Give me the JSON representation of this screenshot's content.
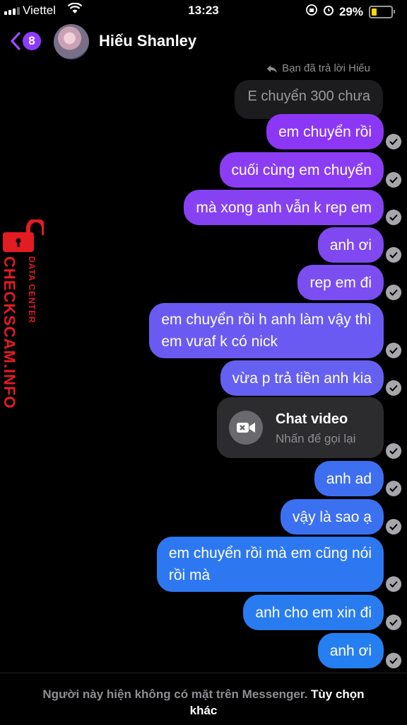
{
  "status": {
    "carrier": "Viettel",
    "time": "13:23",
    "battery": "29%",
    "accent": "#ffd60a"
  },
  "header": {
    "back_count": "8",
    "name": "Hiếu Shanley"
  },
  "reply_note": "Bạn đã trả lời Hiếu",
  "quoted": "E chuyển 300 chưa",
  "messages": [
    {
      "text": "em chuyển rồi",
      "color": "#8c37f5"
    },
    {
      "text": "cuối cùng em chuyển",
      "color": "#8a3df4"
    },
    {
      "text": "mà xong anh vẫn k rep em",
      "color": "#8642f2"
    },
    {
      "text": "anh ơi",
      "color": "#7f48f0"
    },
    {
      "text": "rep em đi",
      "color": "#7a4ef1"
    },
    {
      "text": "em chuyển rồi h anh làm vậy thì\nem vưaf k có nick",
      "color": "#6b5af1"
    },
    {
      "text": "vừa p trả tiền anh kia",
      "color": "#6560f2"
    },
    {
      "text": "anh ad",
      "color": "#3e6ff0"
    },
    {
      "text": "vậy là sao ạ",
      "color": "#3b70f0"
    },
    {
      "text": "em chuyển rồi mà em cũng nói\nrồi mà",
      "color": "#2d78f0"
    },
    {
      "text": "anh cho em xin đi",
      "color": "#287cf0"
    },
    {
      "text": "anh ơi",
      "color": "#267ff0"
    }
  ],
  "call": {
    "title": "Chat video",
    "subtitle": "Nhấn để gọi lại"
  },
  "footer": {
    "text": "Người này hiện không có mặt trên Messenger.",
    "option": "Tùy chọn khác"
  },
  "watermark": {
    "brand": "CHECKSCAM.INFO",
    "tag": "DATA CENTER",
    "color": "#e31b23"
  }
}
